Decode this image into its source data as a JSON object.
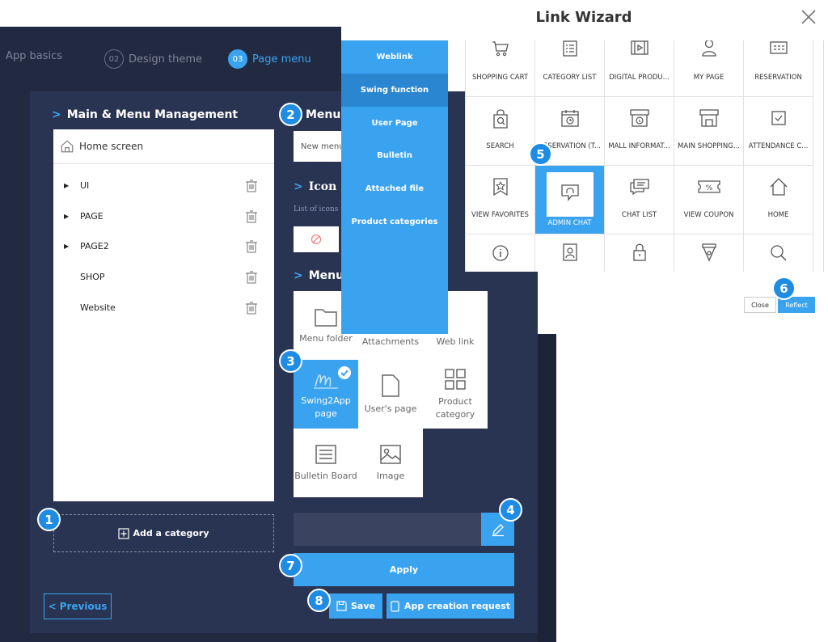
{
  "steps": [
    {
      "num": "",
      "label": "App basics"
    },
    {
      "num": "02",
      "label": "Design theme"
    },
    {
      "num": "03",
      "label": "Page menu"
    }
  ],
  "management": {
    "title": "Main & Menu Management",
    "home_label": "Home screen",
    "categories": [
      {
        "label": "UI",
        "expandable": true
      },
      {
        "label": "PAGE",
        "expandable": true
      },
      {
        "label": "PAGE2",
        "expandable": true
      },
      {
        "label": "SHOP",
        "expandable": false
      },
      {
        "label": "Website",
        "expandable": false
      }
    ],
    "add_category_label": "Add a category",
    "previous_label": "Previous"
  },
  "menu_panel": {
    "menu_heading": "Menu",
    "menu_name_value": "New menu",
    "icon_heading": "Icon",
    "icons_hint": "List of icons",
    "menu_type_heading": "Menu",
    "types": [
      {
        "label": "Menu folder",
        "icon": "folder-icon"
      },
      {
        "label": "Attachments",
        "icon": "attachment-icon"
      },
      {
        "label": "Web link",
        "icon": "weblink-icon"
      },
      {
        "label": "Swing2App page",
        "icon": "swing2app-icon",
        "selected": true
      },
      {
        "label": "User's page",
        "icon": "user-page-icon"
      },
      {
        "label": "Product category",
        "icon": "product-category-icon"
      },
      {
        "label": "Bulletin Board",
        "icon": "bulletin-board-icon"
      },
      {
        "label": "Image",
        "icon": "image-icon"
      }
    ],
    "apply_label": "Apply",
    "save_label": "Save",
    "request_label": "App creation request"
  },
  "dropdown": {
    "items": [
      "Weblink",
      "Swing function",
      "User Page",
      "Bulletin",
      "Attached file",
      "Product categories"
    ],
    "selected_index": 1
  },
  "wizard": {
    "title": "Link Wizard",
    "items": [
      {
        "label": "SHOPPING CART",
        "icon": "shopping-cart-icon"
      },
      {
        "label": "CATEGORY LIST",
        "icon": "category-list-icon"
      },
      {
        "label": "DIGITAL PRODU...",
        "icon": "digital-product-icon"
      },
      {
        "label": "MY PAGE",
        "icon": "my-page-icon"
      },
      {
        "label": "RESERVATION",
        "icon": "reservation-icon"
      },
      {
        "label": "SEARCH",
        "icon": "search-bag-icon"
      },
      {
        "label": "RESERVATION (T...",
        "icon": "reservation-time-icon"
      },
      {
        "label": "MALL INFORMAT...",
        "icon": "mall-info-icon"
      },
      {
        "label": "MAIN SHOPPING...",
        "icon": "main-shopping-icon"
      },
      {
        "label": "ATTENDANCE C...",
        "icon": "attendance-check-icon"
      },
      {
        "label": "VIEW FAVORITES",
        "icon": "favorites-icon"
      },
      {
        "label": "ADMIN CHAT",
        "icon": "admin-chat-icon",
        "selected": true
      },
      {
        "label": "CHAT LIST",
        "icon": "chat-list-icon"
      },
      {
        "label": "VIEW COUPON",
        "icon": "coupon-icon"
      },
      {
        "label": "HOME",
        "icon": "home-icon"
      },
      {
        "label": "",
        "icon": "info-icon"
      },
      {
        "label": "",
        "icon": "profile-card-icon"
      },
      {
        "label": "",
        "icon": "lock-icon"
      },
      {
        "label": "",
        "icon": "pen-nib-icon"
      },
      {
        "label": "",
        "icon": "search-icon"
      }
    ],
    "close_label": "Close",
    "reflect_label": "Reflect"
  },
  "badges": [
    "1",
    "2",
    "3",
    "4",
    "5",
    "6",
    "7",
    "8"
  ],
  "colors": {
    "accent": "#3aa3f0",
    "panel": "#222a42",
    "badge": "#1e8ce3"
  }
}
